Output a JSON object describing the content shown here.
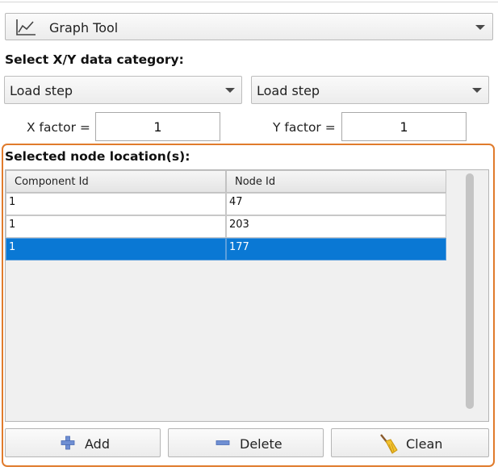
{
  "tool_selector": {
    "label": "Graph Tool",
    "icon": "line-chart-icon"
  },
  "category": {
    "title": "Select X/Y data category:",
    "x_value": "Load step",
    "y_value": "Load step"
  },
  "factors": {
    "x_label": "X factor =",
    "x_value": "1",
    "y_label": "Y factor =",
    "y_value": "1"
  },
  "nodes": {
    "title": "Selected node location(s):",
    "columns": [
      "Component Id",
      "Node Id"
    ],
    "rows": [
      {
        "component_id": "1",
        "node_id": "47",
        "selected": false
      },
      {
        "component_id": "1",
        "node_id": "203",
        "selected": false
      },
      {
        "component_id": "1",
        "node_id": "177",
        "selected": true
      }
    ]
  },
  "buttons": {
    "add": "Add",
    "delete": "Delete",
    "clean": "Clean"
  },
  "colors": {
    "panel_border": "#e07b2c",
    "selection": "#0a78d4",
    "icon_blue": "#5b7fc9"
  }
}
